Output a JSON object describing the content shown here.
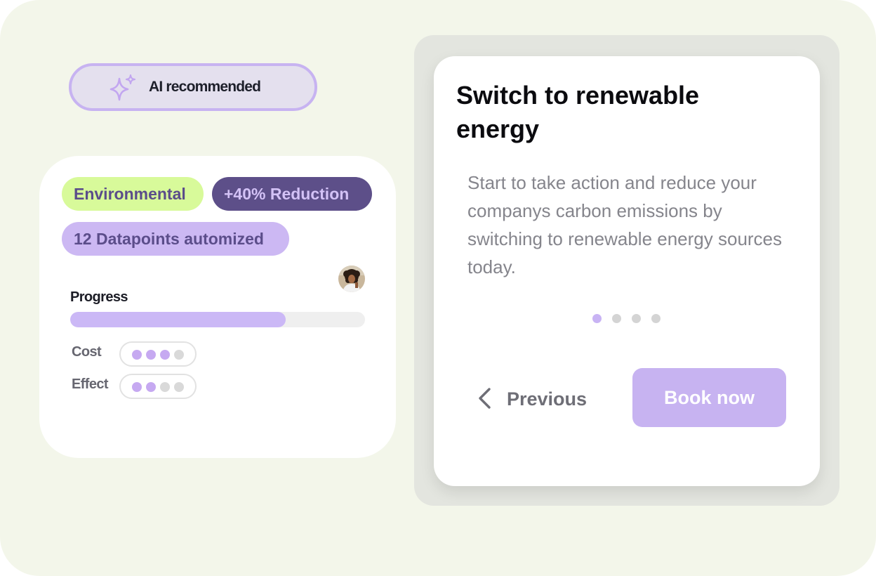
{
  "ai_badge": {
    "label": "AI recommended",
    "icon": "sparkle-icon"
  },
  "summary_card": {
    "tags": [
      "Environmental",
      "+40% Reduction",
      "12 Datapoints automized"
    ],
    "avatar_icon": "user-avatar",
    "progress": {
      "label": "Progress",
      "value_fraction": 0.73
    },
    "cost": {
      "label": "Cost",
      "level": 3,
      "max": 4
    },
    "effect": {
      "label": "Effect",
      "level": 2,
      "max": 4
    }
  },
  "detail_card": {
    "title": "Switch to renewable energy",
    "body": "Start to take action and reduce your companys carbon emissions by switching to renewable energy sources today.",
    "pager": {
      "active_index": 0,
      "total": 4
    },
    "previous_label": "Previous",
    "previous_icon": "chevron-left-icon",
    "book_label": "Book now"
  },
  "colors": {
    "background": "#f3f6ea",
    "accent_purple": "#c7b3f1",
    "dark_purple": "#5d4f89",
    "lime": "#d8fa9a"
  }
}
